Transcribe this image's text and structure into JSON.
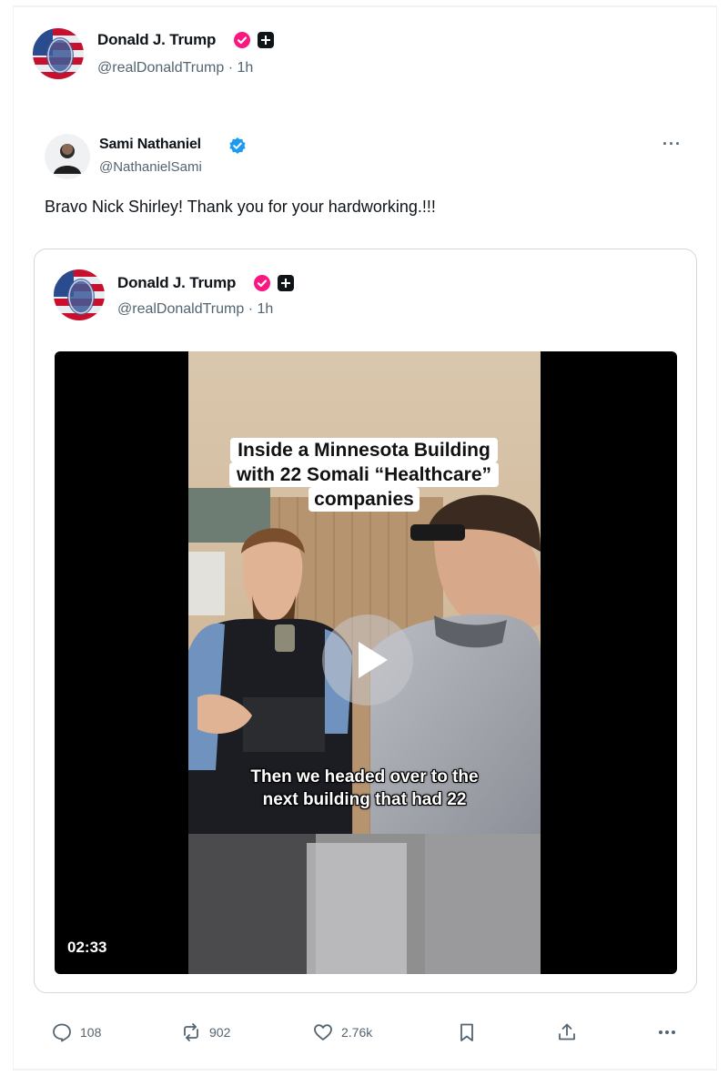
{
  "post": {
    "author": {
      "name": "Donald J. Trump",
      "handle": "@realDonaldTrump",
      "time": "1h",
      "avatar_icon": "flag-face-avatar"
    },
    "repost": {
      "author": {
        "name": "Sami Nathaniel",
        "handle": "@NathanielSami",
        "avatar_icon": "person-avatar"
      },
      "text": "Bravo Nick Shirley! Thank you for your hardworking.!!!",
      "more_icon": "more-horizontal-icon",
      "quoted": {
        "author": {
          "name": "Donald J. Trump",
          "handle": "@realDonaldTrump",
          "time": "1h"
        },
        "video": {
          "caption_lines": [
            "Inside a Minnesota Building",
            "with 22 Somali “Healthcare”",
            "companies"
          ],
          "subtitle_lines": [
            "Then we headed over to the",
            "next building that had 22"
          ],
          "duration": "02:33",
          "play_icon": "play-icon"
        }
      }
    },
    "actions": {
      "replies": "108",
      "reposts": "902",
      "likes": "2.76k",
      "icons": [
        "reply-icon",
        "repost-icon",
        "like-icon",
        "bookmark-icon",
        "share-icon",
        "more-horizontal-icon"
      ]
    }
  },
  "colors": {
    "verified_badge": "#f91880",
    "verified_blue": "#1d9bf0",
    "secondary_text": "#536471",
    "border": "#cfd9de"
  }
}
